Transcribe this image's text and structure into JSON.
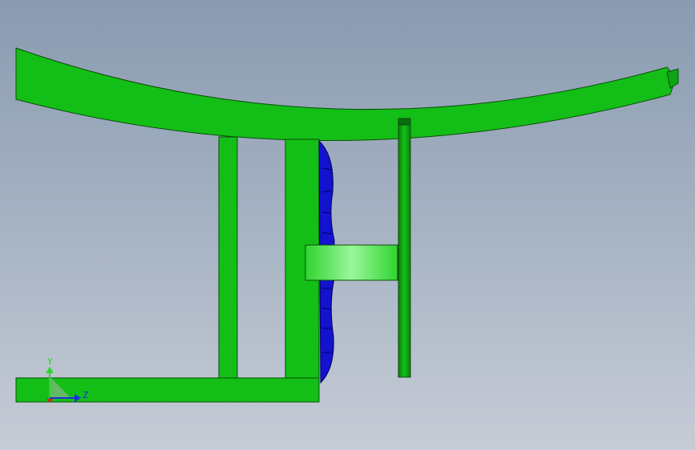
{
  "viewport": {
    "background_top": "#8a9bb0",
    "background_bottom": "#c6ccd6"
  },
  "model": {
    "part_color": "#13bf16",
    "part_edge_color": "#0a4d0a",
    "fan_color": "#1010cc",
    "fan_edge_color": "#00005a",
    "hub_highlight_color": "#8ef58e"
  },
  "triad": {
    "y_label": "Y",
    "z_label": "Z",
    "y_color": "#2bd52b",
    "z_color": "#1e2fe0",
    "x_color": "#e01e1e"
  }
}
